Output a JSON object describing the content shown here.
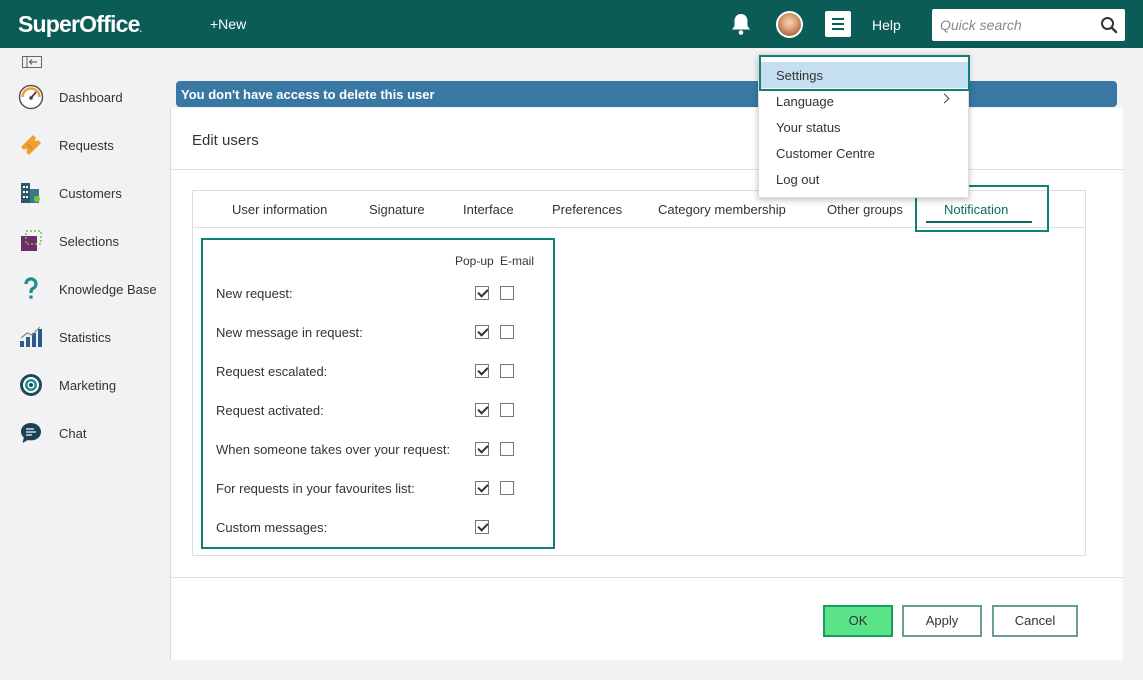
{
  "header": {
    "logo_text": "SuperOffice",
    "logo_mark": ".",
    "new_label": "+New",
    "help_label": "Help",
    "search_placeholder": "Quick search"
  },
  "sidebar": {
    "items": [
      {
        "label": "Dashboard",
        "icon": "gauge-icon"
      },
      {
        "label": "Requests",
        "icon": "ticket-icon"
      },
      {
        "label": "Customers",
        "icon": "buildings-icon"
      },
      {
        "label": "Selections",
        "icon": "selection-icon"
      },
      {
        "label": "Knowledge Base",
        "icon": "question-icon"
      },
      {
        "label": "Statistics",
        "icon": "bar-chart-icon"
      },
      {
        "label": "Marketing",
        "icon": "target-icon"
      },
      {
        "label": "Chat",
        "icon": "chat-bubble-icon"
      }
    ]
  },
  "banner": {
    "text": "You don't have access to delete this user"
  },
  "panel": {
    "title": "Edit users",
    "tabs": [
      {
        "label": "User information"
      },
      {
        "label": "Signature"
      },
      {
        "label": "Interface"
      },
      {
        "label": "Preferences"
      },
      {
        "label": "Category membership"
      },
      {
        "label": "Other groups"
      },
      {
        "label": "Notification",
        "active": true
      }
    ]
  },
  "notification": {
    "col_popup": "Pop-up",
    "col_email": "E-mail",
    "rows": [
      {
        "label": "New request:",
        "popup": true,
        "email": false
      },
      {
        "label": "New message in request:",
        "popup": true,
        "email": false
      },
      {
        "label": "Request escalated:",
        "popup": true,
        "email": false
      },
      {
        "label": "Request activated:",
        "popup": true,
        "email": false
      },
      {
        "label": "When someone takes over your request:",
        "popup": true,
        "email": false
      },
      {
        "label": "For requests in your favourites list:",
        "popup": true,
        "email": false
      },
      {
        "label": "Custom messages:",
        "popup": true,
        "email": null
      }
    ]
  },
  "buttons": {
    "ok": "OK",
    "apply": "Apply",
    "cancel": "Cancel"
  },
  "menu": {
    "items": [
      {
        "label": "Settings",
        "selected": true
      },
      {
        "label": "Language",
        "submenu": true
      },
      {
        "label": "Your status"
      },
      {
        "label": "Customer Centre"
      },
      {
        "label": "Log out"
      }
    ]
  },
  "colors": {
    "topbar": "#0b5c57",
    "banner": "#3a78a4",
    "highlight": "#0e8078",
    "ok_button": "#5be38a",
    "menu_selected": "#c6dff0"
  }
}
